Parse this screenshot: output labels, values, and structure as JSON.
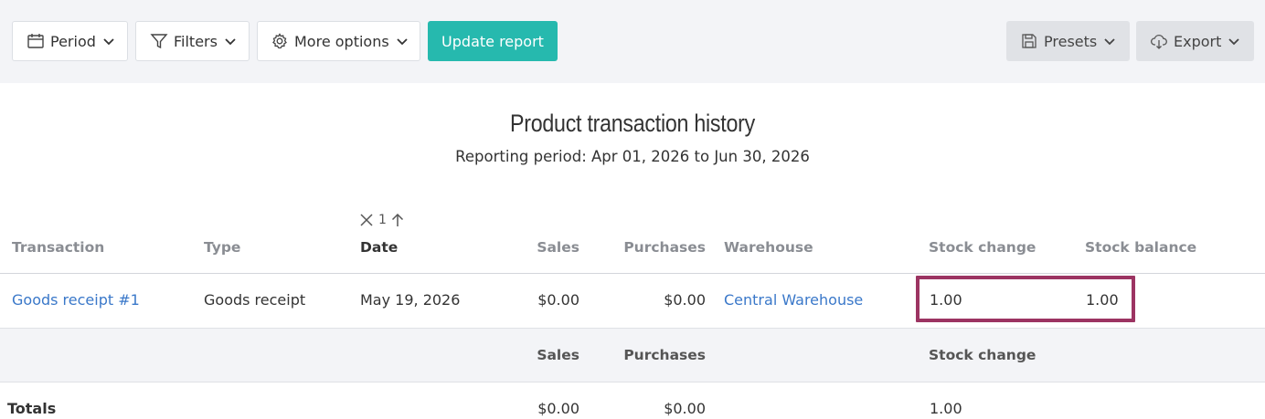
{
  "toolbar": {
    "period_label": "Period",
    "filters_label": "Filters",
    "more_options_label": "More options",
    "update_report_label": "Update report",
    "presets_label": "Presets",
    "export_label": "Export"
  },
  "report": {
    "title": "Product transaction history",
    "period": "Reporting period: Apr 01, 2026 to Jun 30, 2026"
  },
  "sort": {
    "priority": "1",
    "direction": "ascending"
  },
  "table": {
    "columns": {
      "transaction": "Transaction",
      "type": "Type",
      "date": "Date",
      "sales": "Sales",
      "purchases": "Purchases",
      "warehouse": "Warehouse",
      "stock_change": "Stock change",
      "stock_balance": "Stock balance"
    },
    "rows": [
      {
        "transaction": "Goods receipt #1",
        "type": "Goods receipt",
        "date": "May 19, 2026",
        "sales": "$0.00",
        "purchases": "$0.00",
        "warehouse": "Central Warehouse",
        "stock_change": "1.00",
        "stock_balance": "1.00"
      }
    ],
    "totals": {
      "headers": {
        "sales": "Sales",
        "purchases": "Purchases",
        "stock_change": "Stock change"
      },
      "label": "Totals",
      "sales": "$0.00",
      "purchases": "$0.00",
      "stock_change": "1.00"
    }
  },
  "colors": {
    "accent": "#26b9ae",
    "link": "#3a78c9",
    "highlight": "#9c3462"
  }
}
